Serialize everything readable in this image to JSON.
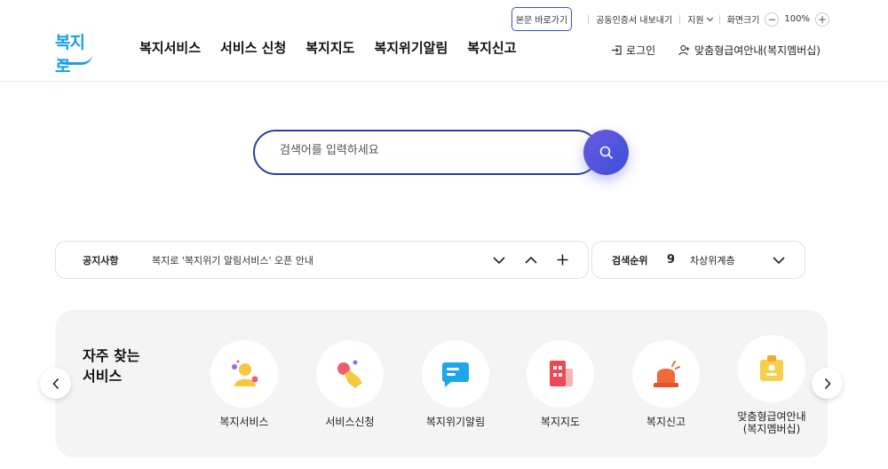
{
  "utility": {
    "skip_label": "본문 바로가기",
    "cert_label": "공동인증서 내보내기",
    "support_label": "지원",
    "zoom_label": "화면크기",
    "zoom_value": "100%",
    "zoom_minus": "−",
    "zoom_plus": "+"
  },
  "logo": {
    "text": "복지로"
  },
  "nav": {
    "items": [
      "복지서비스",
      "서비스 신청",
      "복지지도",
      "복지위기알림",
      "복지신고"
    ]
  },
  "header_right": {
    "login_label": "로그인",
    "guide_label": "맞춤형급여안내(복지멤버십)"
  },
  "search": {
    "placeholder": "검색어를 입력하세요"
  },
  "notice": {
    "title": "공지사항",
    "text": "복지로 '복지위기 알림서비스' 오픈 안내"
  },
  "rank": {
    "title": "검색순위",
    "number": "9",
    "word": "차상위계층"
  },
  "frequent": {
    "title_line1": "자주 찾는",
    "title_line2": "서비스",
    "items": [
      {
        "label": "복지서비스",
        "icon": "person-icon"
      },
      {
        "label": "서비스신청",
        "icon": "hand-touch-icon"
      },
      {
        "label": "복지위기알림",
        "icon": "chat-message-icon"
      },
      {
        "label": "복지지도",
        "icon": "building-icon"
      },
      {
        "label": "복지신고",
        "icon": "siren-icon"
      },
      {
        "label": "맞춤형급여안내\n(복지멤버십)",
        "label_line1": "맞춤형급여안내",
        "label_line2": "(복지멤버십)",
        "icon": "id-badge-icon"
      }
    ]
  },
  "colors": {
    "brand_blue": "#1a9fe3",
    "search_border": "#2c3ba8",
    "search_button": "#4f55dd"
  }
}
